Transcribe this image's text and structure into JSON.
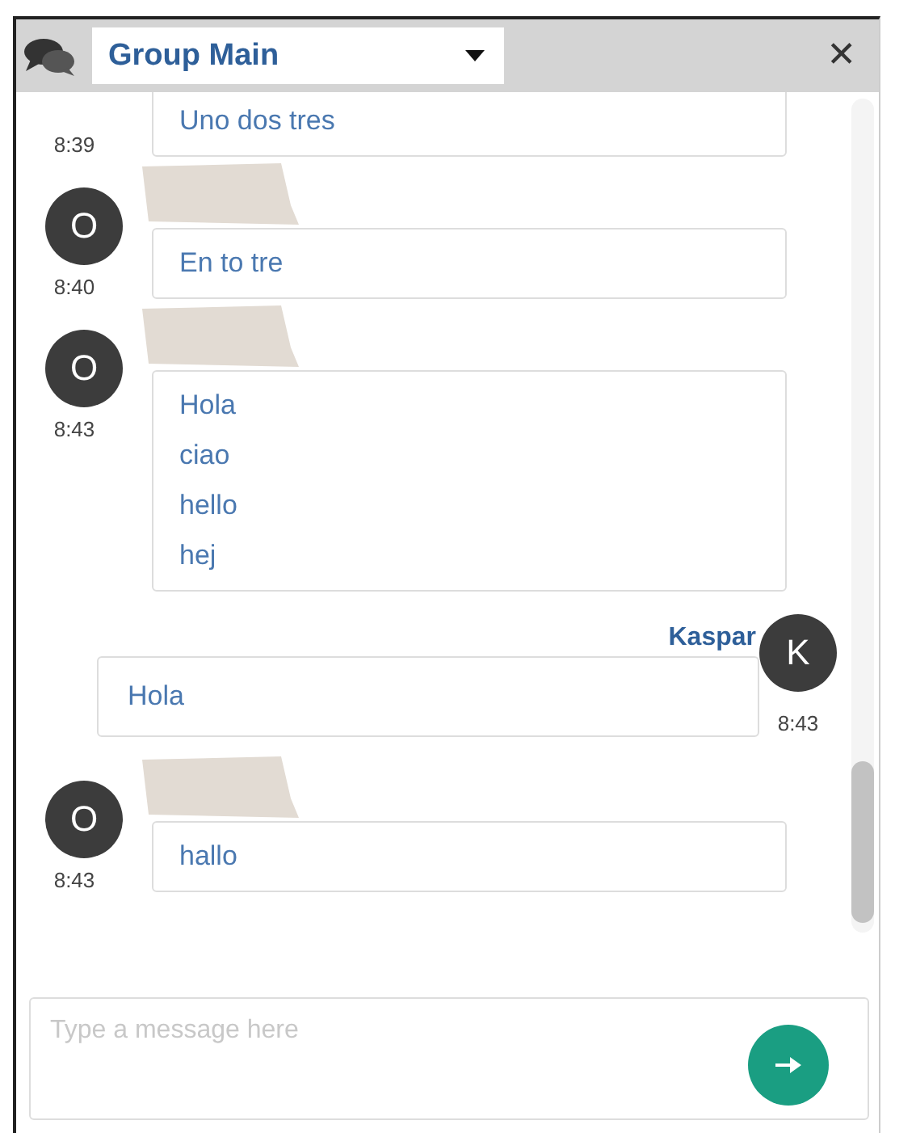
{
  "header": {
    "title": "Group Main",
    "close": "✕"
  },
  "messages": [
    {
      "kind": "incoming",
      "time": "8:39",
      "lines": [
        "Uno dos tres"
      ]
    },
    {
      "kind": "incoming",
      "avatar": "O",
      "name_redacted": true,
      "time": "8:40",
      "lines": [
        "En to tre"
      ]
    },
    {
      "kind": "incoming",
      "avatar": "O",
      "name_redacted": true,
      "time": "8:43",
      "lines": [
        "Hola",
        "ciao",
        "hello",
        "hej"
      ]
    },
    {
      "kind": "outgoing",
      "avatar": "K",
      "sender": "Kaspar",
      "time": "8:43",
      "lines": [
        "Hola"
      ]
    },
    {
      "kind": "incoming",
      "avatar": "O",
      "name_redacted": true,
      "time": "8:43",
      "lines": [
        "hallo"
      ]
    }
  ],
  "composer": {
    "placeholder": "Type a message here"
  }
}
